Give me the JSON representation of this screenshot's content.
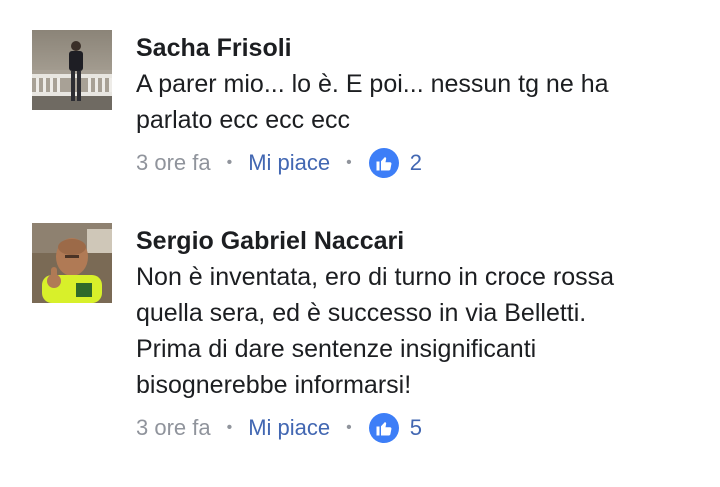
{
  "colors": {
    "author": "#1c1e21",
    "text": "#1c1e21",
    "meta": "#90949c",
    "link": "#4267b2",
    "like_badge": "#3d7ef7"
  },
  "comments": [
    {
      "author": "Sacha Frisoli",
      "text_lines": [
        "A parer mio... lo è. E poi... nessun tg ne ha",
        "parlato ecc ecc ecc"
      ],
      "time": "3 ore fa",
      "like_label": "Mi piace",
      "like_count": "2",
      "like_icon": "thumbs-up-icon"
    },
    {
      "author": "Sergio Gabriel Naccari",
      "text_lines": [
        "Non è inventata, ero di turno in croce rossa",
        "quella sera, ed è successo in via Belletti.",
        "Prima di dare sentenze insignificanti",
        "bisognerebbe informarsi!"
      ],
      "time": "3 ore fa",
      "like_label": "Mi piace",
      "like_count": "5",
      "like_icon": "thumbs-up-icon"
    }
  ]
}
